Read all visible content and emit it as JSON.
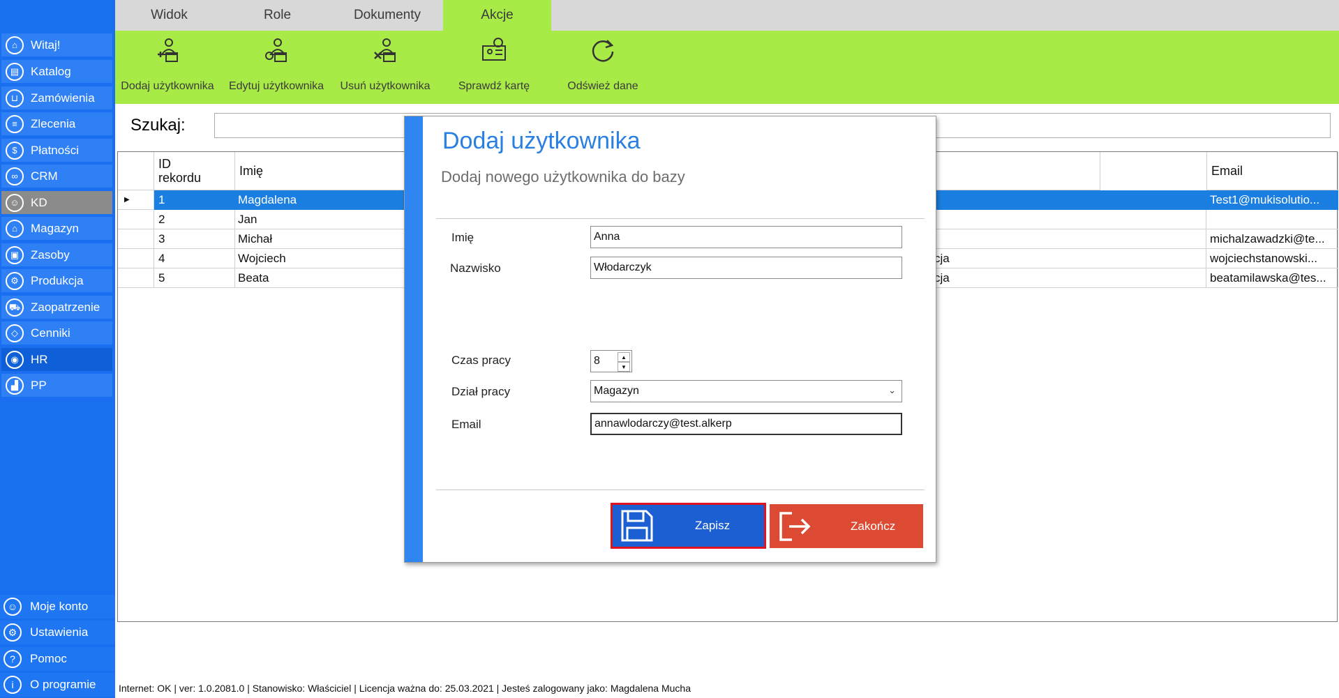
{
  "sidebar": {
    "items": [
      {
        "label": "Witaj!",
        "icon": "home-icon",
        "glyph": "⌂"
      },
      {
        "label": "Katalog",
        "icon": "book-icon",
        "glyph": "▤"
      },
      {
        "label": "Zamówienia",
        "icon": "cart-icon",
        "glyph": "⊔"
      },
      {
        "label": "Zlecenia",
        "icon": "list-icon",
        "glyph": "≡"
      },
      {
        "label": "Płatności",
        "icon": "dollar-icon",
        "glyph": "$"
      },
      {
        "label": "CRM",
        "icon": "crm-icon",
        "glyph": "∞"
      },
      {
        "label": "KD",
        "icon": "user-icon",
        "glyph": "☺"
      },
      {
        "label": "Magazyn",
        "icon": "warehouse-icon",
        "glyph": "⌂"
      },
      {
        "label": "Zasoby",
        "icon": "box-icon",
        "glyph": "▣"
      },
      {
        "label": "Produkcja",
        "icon": "gear-icon",
        "glyph": "⚙"
      },
      {
        "label": "Zaopatrzenie",
        "icon": "truck-icon",
        "glyph": "⛟"
      },
      {
        "label": "Cenniki",
        "icon": "tag-icon",
        "glyph": "◇"
      },
      {
        "label": "HR",
        "icon": "id-icon",
        "glyph": "◉"
      },
      {
        "label": "PP",
        "icon": "factory-icon",
        "glyph": "▟"
      }
    ],
    "bottom": [
      {
        "label": "Moje konto",
        "icon": "account-icon",
        "glyph": "☺"
      },
      {
        "label": "Ustawienia",
        "icon": "settings-icon",
        "glyph": "⚙"
      },
      {
        "label": "Pomoc",
        "icon": "help-icon",
        "glyph": "?"
      },
      {
        "label": "O programie",
        "icon": "info-icon",
        "glyph": "i"
      }
    ]
  },
  "tabs": [
    "Widok",
    "Role",
    "Dokumenty",
    "Akcje"
  ],
  "ribbon": {
    "buttons": [
      {
        "label": "Dodaj użytkownika",
        "icon": "add-user-icon"
      },
      {
        "label": "Edytuj użytkownika",
        "icon": "edit-user-icon"
      },
      {
        "label": "Usuń użytkownika",
        "icon": "delete-user-icon"
      },
      {
        "label": "Sprawdź kartę",
        "icon": "card-icon"
      },
      {
        "label": "Odśwież dane",
        "icon": "refresh-icon"
      }
    ]
  },
  "search": {
    "label": "Szukaj:",
    "value": ""
  },
  "grid": {
    "headers": {
      "id": "ID\nrekordu",
      "name": "Imię",
      "email": "Email"
    },
    "rows": [
      {
        "id": "1",
        "name": "Magdalena",
        "mid": "",
        "email": "Test1@mukisolutio..."
      },
      {
        "id": "2",
        "name": "Jan",
        "mid": "",
        "email": ""
      },
      {
        "id": "3",
        "name": "Michał",
        "mid": "",
        "email": "michalzawadzki@te..."
      },
      {
        "id": "4",
        "name": "Wojciech",
        "mid": "cja",
        "email": "wojciechstanowski..."
      },
      {
        "id": "5",
        "name": "Beata",
        "mid": "cja",
        "email": "beatamilawska@tes..."
      }
    ]
  },
  "modal": {
    "title": "Dodaj użytkownika",
    "subtitle": "Dodaj nowego użytkownika do bazy",
    "fields": {
      "imie": {
        "label": "Imię",
        "value": "Anna"
      },
      "nazwisko": {
        "label": "Nazwisko",
        "value": "Włodarczyk"
      },
      "czas": {
        "label": "Czas pracy",
        "value": "8"
      },
      "dzial": {
        "label": "Dział pracy",
        "value": "Magazyn"
      },
      "email": {
        "label": "Email",
        "value": "annawlodarczy@test.alkerp"
      }
    },
    "save_label": "Zapisz",
    "close_label": "Zakończ"
  },
  "status": "Internet: OK  |   ver: 1.0.2081.0   |   Stanowisko: Właściciel    |   Licencja ważna do: 25.03.2021   |   Jesteś zalogowany jako: Magdalena Mucha",
  "colors": {
    "accent": "#a8ea46",
    "sidebar": "#1a6ef0",
    "save": "#1b5fd2",
    "close": "#dc4a34"
  }
}
